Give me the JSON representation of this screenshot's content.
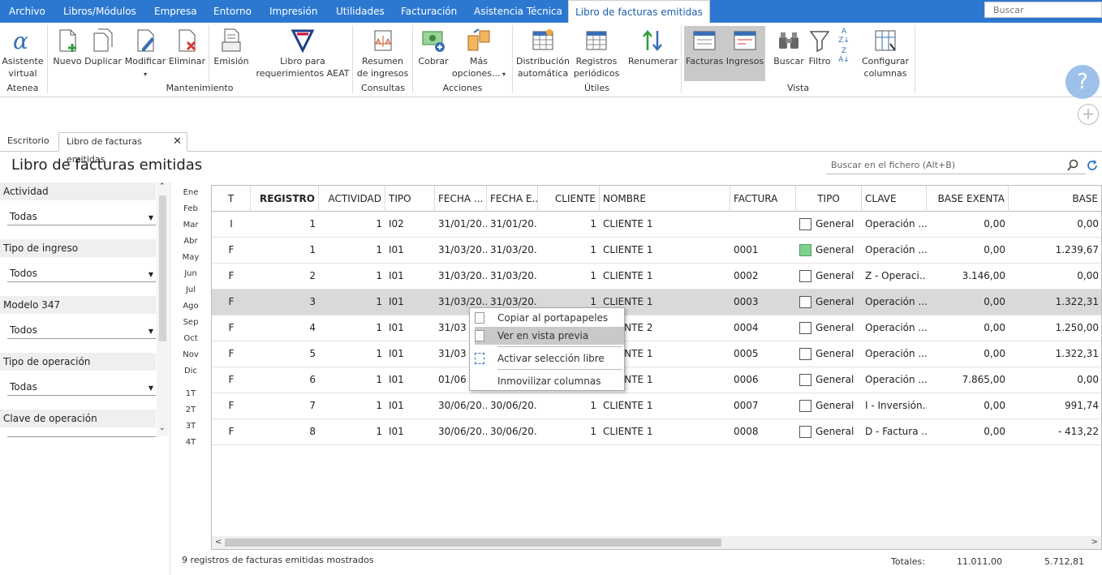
{
  "menu": {
    "items": [
      "Archivo",
      "Libros/Módulos",
      "Empresa",
      "Entorno",
      "Impresión",
      "Utilidades",
      "Facturación",
      "Asistencia Técnica"
    ],
    "active": "Libro de facturas emitidas",
    "search_placeholder": "Buscar"
  },
  "ribbon": {
    "asistente": "Asistente",
    "virtual": "virtual",
    "nuevo": "Nuevo",
    "duplicar": "Duplicar",
    "modificar": "Modificar",
    "eliminar": "Eliminar",
    "emision": "Emisión",
    "libro_para": "Libro para",
    "requerimientos": "requerimientos AEAT",
    "resumen": "Resumen",
    "de_ingresos": "de ingresos",
    "cobrar": "Cobrar",
    "mas": "Más",
    "opciones": "opciones...",
    "distribucion": "Distribución",
    "automatica": "automática",
    "registros": "Registros",
    "periodicos": "periódicos",
    "renumerar": "Renumerar",
    "facturas": "Facturas",
    "ingresos": "Ingresos",
    "buscar": "Buscar",
    "filtro": "Filtro",
    "configurar": "Configurar",
    "columnas": "columnas",
    "groups": {
      "atenea": "Atenea",
      "mantenimiento": "Mantenimiento",
      "consultas": "Consultas",
      "acciones": "Acciones",
      "utiles": "Útiles",
      "vista": "Vista"
    }
  },
  "tabs": {
    "escritorio": "Escritorio",
    "libro": "Libro de facturas emitidas"
  },
  "page": {
    "title": "Libro de facturas emitidas",
    "search_placeholder": "Buscar en el fichero (Alt+B)"
  },
  "filters": {
    "actividad": {
      "label": "Actividad",
      "value": "Todas"
    },
    "tipo_ingreso": {
      "label": "Tipo de ingreso",
      "value": "Todos"
    },
    "modelo347": {
      "label": "Modelo 347",
      "value": "Todos"
    },
    "tipo_operacion": {
      "label": "Tipo de operación",
      "value": "Todas"
    },
    "clave_operacion": {
      "label": "Clave de operación"
    }
  },
  "months": [
    "Ene",
    "Feb",
    "Mar",
    "Abr",
    "May",
    "Jun",
    "Jul",
    "Ago",
    "Sep",
    "Oct",
    "Nov",
    "Dic",
    "1T",
    "2T",
    "3T",
    "4T"
  ],
  "table": {
    "headers": [
      "T",
      "REGISTRO",
      "ACTIVIDAD",
      "TIPO",
      "FECHA ...",
      "FECHA E...",
      "CLIENTE",
      "NOMBRE",
      "FACTURA",
      "TIPO",
      "CLAVE",
      "BASE EXENTA",
      "BASE"
    ],
    "rows": [
      [
        "I",
        "1",
        "1",
        "I02",
        "31/01/20...",
        "31/01/20...",
        "1",
        "CLIENTE 1",
        "",
        "General",
        "Operación ...",
        "0,00",
        "0,00"
      ],
      [
        "F",
        "1",
        "1",
        "I01",
        "31/03/20...",
        "31/03/20...",
        "1",
        "CLIENTE 1",
        "0001",
        "General",
        "Operación ...",
        "0,00",
        "1.239,67"
      ],
      [
        "F",
        "2",
        "1",
        "I01",
        "31/03/20...",
        "31/03/20...",
        "1",
        "CLIENTE 1",
        "0002",
        "General",
        "Z - Operaci...",
        "3.146,00",
        "0,00"
      ],
      [
        "F",
        "3",
        "1",
        "I01",
        "31/03/20...",
        "31/03/20...",
        "1",
        "CLIENTE 1",
        "0003",
        "General",
        "Operación ...",
        "0,00",
        "1.322,31"
      ],
      [
        "F",
        "4",
        "1",
        "I01",
        "31/03",
        "",
        "",
        "CLIENTE 2",
        "0004",
        "General",
        "Operación ...",
        "0,00",
        "1.250,00"
      ],
      [
        "F",
        "5",
        "1",
        "I01",
        "31/03",
        "",
        "",
        "CLIENTE 1",
        "0005",
        "General",
        "Operación ...",
        "0,00",
        "1.322,31"
      ],
      [
        "F",
        "6",
        "1",
        "I01",
        "01/06",
        "",
        "",
        "CLIENTE 1",
        "0006",
        "General",
        "Operación ...",
        "7.865,00",
        "0,00"
      ],
      [
        "F",
        "7",
        "1",
        "I01",
        "30/06/20...",
        "30/06/20...",
        "1",
        "CLIENTE 1",
        "0007",
        "General",
        "I - Inversión...",
        "0,00",
        "991,74"
      ],
      [
        "F",
        "8",
        "1",
        "I01",
        "30/06/20...",
        "30/06/20...",
        "1",
        "CLIENTE 1",
        "0008",
        "General",
        "D - Factura ...",
        "0,00",
        "- 413,22"
      ]
    ],
    "checked_row": 1,
    "selected_row": 3
  },
  "context_menu": {
    "copy": "Copiar al portapapeles",
    "preview": "Ver en vista previa",
    "free_select": "Activar selección libre",
    "freeze": "Inmovilizar columnas"
  },
  "footer": {
    "count": "9 registros de facturas emitidas mostrados",
    "totales_label": "Totales:",
    "total_exenta": "11.011,00",
    "total_base": "5.712,81"
  },
  "colors": {
    "menubar": "#2c78d0",
    "accent": "#1d5fb0",
    "selected_row": "#d9d9d9"
  }
}
